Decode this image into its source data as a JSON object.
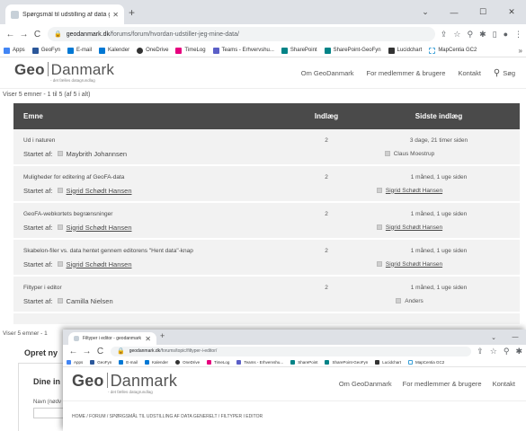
{
  "browser": {
    "tab_title": "Spørgsmål til udstilling af data g",
    "url_host": "geodanmark.dk",
    "url_path": "/forums/forum/hvordan-udstiller-jeg-mine-data/",
    "bookmarks": [
      {
        "label": "Apps",
        "color": "#4285f4"
      },
      {
        "label": "GeoFyn",
        "color": "#2b579a"
      },
      {
        "label": "E-mail",
        "color": "#0078d4"
      },
      {
        "label": "Kalender",
        "color": "#0078d4"
      },
      {
        "label": "OneDrive",
        "color": "#333"
      },
      {
        "label": "TimeLog",
        "color": "#e6007e"
      },
      {
        "label": "Teams - Erhvervshu...",
        "color": "#5b5fc7"
      },
      {
        "label": "SharePoint",
        "color": "#038387"
      },
      {
        "label": "SharePoint-GeoFyn",
        "color": "#038387"
      },
      {
        "label": "Lucidchart",
        "color": "#333"
      },
      {
        "label": "MapCentia GC2",
        "color": "#3aa0d8"
      }
    ]
  },
  "site": {
    "logo_a": "Geo",
    "logo_b": "Danmark",
    "logo_tagline": "- det fælles datagrundlag",
    "nav": [
      "Om GeoDanmark",
      "For medlemmer & brugere",
      "Kontakt"
    ],
    "search_label": "Søg"
  },
  "forum": {
    "count_text": "Viser 5 emner - 1 til 5 (af 5 i alt)",
    "headers": {
      "topic": "Emne",
      "posts": "Indlæg",
      "last": "Sidste indlæg"
    },
    "started_by_label": "Startet af:",
    "rows": [
      {
        "title": "Ud i naturen",
        "author": "Maybrith Johannsen",
        "posts": "2",
        "last_time": "3 dage, 21 timer siden",
        "last_author": "Claus Moestrup",
        "linked": false
      },
      {
        "title": "Muligheder for editering af GeoFA-data",
        "author": "Sigrid Schødt Hansen",
        "posts": "2",
        "last_time": "1 måned, 1 uge siden",
        "last_author": "Sigrid Schødt Hansen",
        "linked": true
      },
      {
        "title": "GeoFA-webkortets begrænsninger",
        "author": "Sigrid Schødt Hansen",
        "posts": "2",
        "last_time": "1 måned, 1 uge siden",
        "last_author": "Sigrid Schødt Hansen",
        "linked": true
      },
      {
        "title": "Skabelon-filer vs. data hentet gennem editorens \"Hent data\"-knap",
        "author": "Sigrid Schødt Hansen",
        "posts": "2",
        "last_time": "1 måned, 1 uge siden",
        "last_author": "Sigrid Schødt Hansen",
        "linked": true
      },
      {
        "title": "Filtyper i editor",
        "author": "Camilla Nielsen",
        "posts": "2",
        "last_time": "1 måned, 1 uge siden",
        "last_author": "Anders",
        "linked": false
      }
    ]
  },
  "below": {
    "count_text": "Viser 5 emner - 1",
    "opret": "Opret ny",
    "dine": "Dine in",
    "navn": "Navn (nødv"
  },
  "window2": {
    "tab_title": "Filtyper i editor - geodanmark",
    "url_host": "geodanmark.dk",
    "url_path": "/forums/topic/filtyper-i-editor/",
    "breadcrumb": "HOME / FORUM / SPØRGSMÅL TIL UDSTILLING AF DATA GENERELT / FILTYPER I EDITOR"
  }
}
